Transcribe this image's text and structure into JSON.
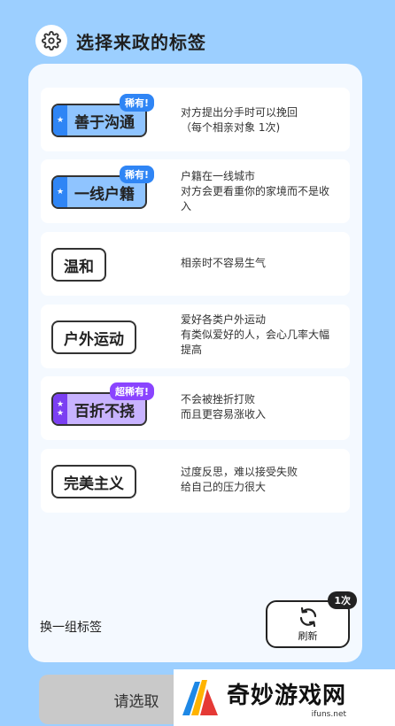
{
  "header": {
    "title": "选择来政的标签",
    "icon": "gear-icon"
  },
  "tags": [
    {
      "label": "善于沟通",
      "style": "blue",
      "stars": 1,
      "badge": "稀有!",
      "desc_lines": [
        "对方提出分手时可以挽回",
        "（每个相亲对象 1次)"
      ]
    },
    {
      "label": "一线户籍",
      "style": "blue",
      "stars": 1,
      "badge": "稀有!",
      "desc_lines": [
        "户籍在一线城市",
        "对方会更看重你的家境而不是收",
        "入"
      ]
    },
    {
      "label": "温和",
      "style": "plain",
      "stars": 0,
      "badge": "",
      "desc_lines": [
        "相亲时不容易生气"
      ]
    },
    {
      "label": "户外运动",
      "style": "plain",
      "stars": 0,
      "badge": "",
      "desc_lines": [
        "爱好各类户外运动",
        "有类似爱好的人，会心几率大幅",
        "提高"
      ]
    },
    {
      "label": "百折不挠",
      "style": "purple",
      "stars": 2,
      "badge": "超稀有!",
      "desc_lines": [
        "不会被挫折打败",
        "而且更容易涨收入"
      ]
    },
    {
      "label": "完美主义",
      "style": "plain",
      "stars": 0,
      "badge": "",
      "desc_lines": [
        "过度反思，难以接受失败",
        "给自己的压力很大"
      ]
    }
  ],
  "footer": {
    "swap_label": "换一组标签",
    "refresh_label": "刷新",
    "refresh_count": "1次",
    "confirm_label": "请选取"
  },
  "watermark": {
    "name": "奇妙游戏网",
    "url": "ifuns.net"
  },
  "colors": {
    "background": "#9ccfff",
    "rare_blue": "#2f85f5",
    "super_rare_purple": "#8a44ff"
  }
}
